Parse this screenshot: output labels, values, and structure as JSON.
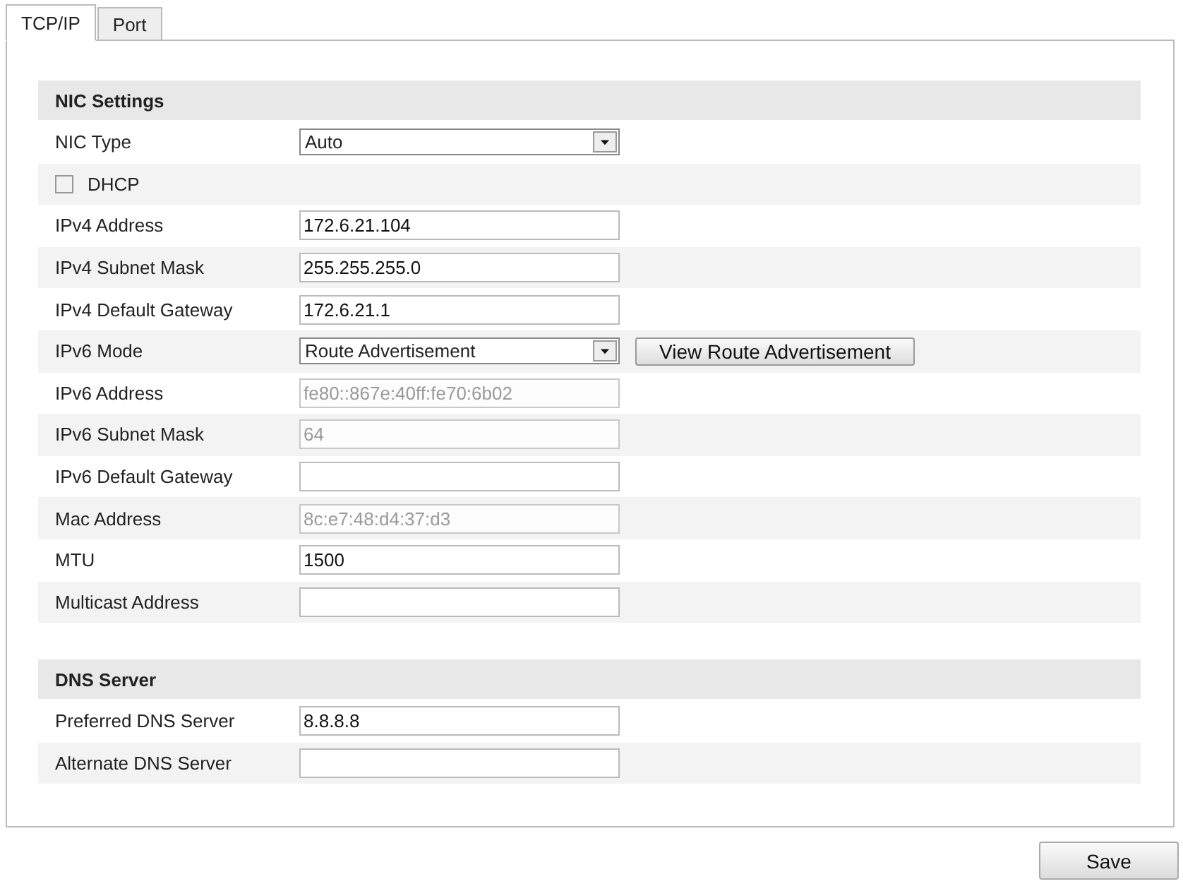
{
  "tabs": [
    {
      "label": "TCP/IP",
      "selected": true
    },
    {
      "label": "Port",
      "selected": false
    }
  ],
  "sections": [
    {
      "title": "NIC Settings",
      "rows": [
        {
          "kind": "select",
          "label": "NIC Type",
          "value": "Auto"
        },
        {
          "kind": "checkbox",
          "label": "DHCP",
          "checked": false
        },
        {
          "kind": "input",
          "label": "IPv4 Address",
          "value": "172.6.21.104",
          "disabled": false
        },
        {
          "kind": "input",
          "label": "IPv4 Subnet Mask",
          "value": "255.255.255.0",
          "disabled": false
        },
        {
          "kind": "input",
          "label": "IPv4 Default Gateway",
          "value": "172.6.21.1",
          "disabled": false
        },
        {
          "kind": "select",
          "label": "IPv6 Mode",
          "value": "Route Advertisement",
          "button": "View Route Advertisement"
        },
        {
          "kind": "input",
          "label": "IPv6 Address",
          "value": "fe80::867e:40ff:fe70:6b02",
          "disabled": true
        },
        {
          "kind": "input",
          "label": "IPv6 Subnet Mask",
          "value": "64",
          "disabled": true
        },
        {
          "kind": "input",
          "label": "IPv6 Default Gateway",
          "disabled": false
        },
        {
          "kind": "input",
          "label": "Mac Address",
          "value": "8c:e7:48:d4:37:d3",
          "disabled": true
        },
        {
          "kind": "input",
          "label": "MTU",
          "value": "1500",
          "disabled": false
        },
        {
          "kind": "input",
          "label": "Multicast Address",
          "disabled": false
        }
      ]
    },
    {
      "title": "DNS Server",
      "rows": [
        {
          "kind": "input",
          "label": "Preferred DNS Server",
          "value": "8.8.8.8",
          "disabled": false
        },
        {
          "kind": "input",
          "label": "Alternate DNS Server",
          "disabled": false
        }
      ]
    }
  ],
  "save_button": "Save"
}
